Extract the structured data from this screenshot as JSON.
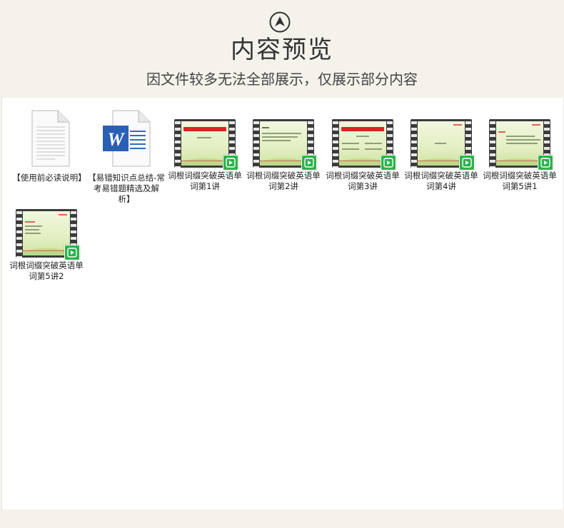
{
  "header": {
    "title": "内容预览",
    "subtitle": "因文件较多无法全部展示，仅展示部分内容",
    "up_icon": "chevron-up-circle-icon"
  },
  "colors": {
    "background": "#f5f2eb",
    "panel": "#ffffff",
    "text": "#222222",
    "play_badge": "#2bb24c"
  },
  "files": [
    {
      "label": "【使用前必读说明】",
      "type": "document",
      "icon": "text-document-icon"
    },
    {
      "label": "【易错知识点总结-常考易错题精选及解析】",
      "type": "word",
      "icon": "word-document-icon"
    },
    {
      "label": "词根词缀突破英语单词第1讲",
      "type": "video",
      "icon": "video-file-icon"
    },
    {
      "label": "词根词缀突破英语单词第2讲",
      "type": "video",
      "icon": "video-file-icon"
    },
    {
      "label": "词根词缀突破英语单词第3讲",
      "type": "video",
      "icon": "video-file-icon"
    },
    {
      "label": "词根词缀突破英语单词第4讲",
      "type": "video",
      "icon": "video-file-icon"
    },
    {
      "label": "词根词缀突破英语单词第5讲1",
      "type": "video",
      "icon": "video-file-icon"
    },
    {
      "label": "词根词缀突破英语单词第5讲2",
      "type": "video",
      "icon": "video-file-icon"
    }
  ]
}
